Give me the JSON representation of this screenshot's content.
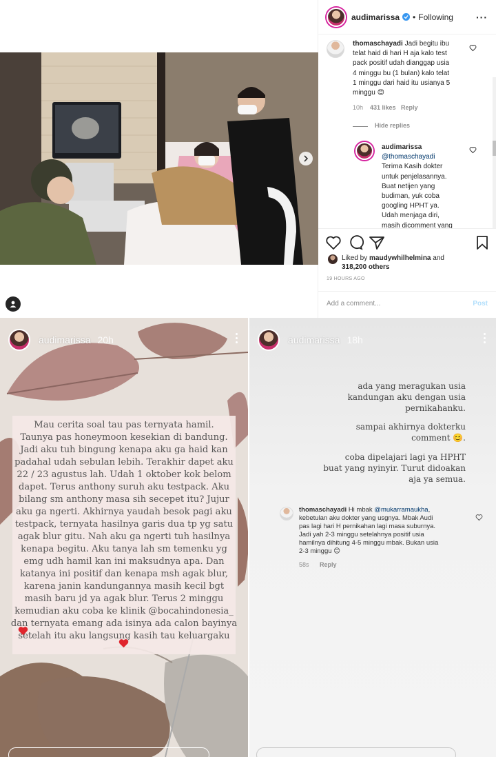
{
  "post": {
    "username": "audimarissa",
    "following_label": "Following",
    "dot": "•",
    "more": "···",
    "comment1": {
      "user": "thomaschayadi",
      "lines": [
        "Jadi begitu ibu",
        "telat haid di hari H aja kalo test",
        "pack positif udah dianggap usia",
        "4 minggu bu (1 bulan) kalo telat",
        "1 minggu dari haid itu usianya 5",
        "minggu 😊"
      ],
      "time": "10h",
      "likes": "431 likes",
      "reply": "Reply"
    },
    "hide_replies": "Hide replies",
    "reply1": {
      "user": "audimarissa",
      "mention": "@thomaschayadi",
      "lines": [
        "Terima Kasih dokter",
        "untuk penjelasannya.",
        "Buat netijen yang",
        "budiman, yuk coba",
        "googling HPHT ya.",
        "Udah menjaga diri,",
        "masih dicomment yang"
      ]
    },
    "liked_by_prefix": "Liked by",
    "liked_by_user": "maudywhilhelmina",
    "liked_by_and": "and",
    "liked_count": "318,200 others",
    "time_ago": "19 HOURS AGO",
    "add_comment_placeholder": "Add a comment...",
    "post_label": "Post"
  },
  "story1": {
    "username": "audimarissa",
    "time": "20h",
    "lines": [
      "Mau cerita soal tau pas ternyata hamil.",
      "Taunya pas honeymoon kesekian di bandung.",
      "Jadi aku tuh bingung kenapa aku ga haid kan",
      "padahal udah sebulan lebih. Terakhir dapet aku",
      "22 / 23 agustus lah. Udah 1 oktober kok belom",
      "dapet. Terus anthony suruh aku testpack. Aku",
      "bilang sm anthony masa sih secepet itu? Jujur",
      "aku ga ngerti. Akhirnya yaudah besok pagi aku",
      "testpack, ternyata hasilnya garis dua tp yg satu",
      "agak blur gitu. Nah aku ga ngerti tuh hasilnya",
      "kenapa begitu. Aku tanya lah sm temenku yg",
      "emg udh hamil kan ini maksudnya apa. Dan",
      "katanya ini positif dan kenapa msh agak blur,",
      "karena janin kandungannya masih kecil bgt",
      "masih baru jd ya agak blur. Terus 2 minggu",
      "kemudian aku coba ke klinik @bocahindonesia_",
      "dan ternyata emang ada isinya ada calon bayinya",
      "setelah itu aku langsung kasih tau keluargaku"
    ]
  },
  "story2": {
    "username": "audimarissa",
    "time": "18h",
    "lines": [
      "ada yang meragukan usia",
      "kandungan aku dengan usia",
      "pernikahanku.",
      "",
      "sampai akhirnya dokterku",
      "comment 😊.",
      "",
      "coba dipelajari lagi ya HPHT",
      "buat yang nyinyir. Turut didoakan",
      "aja ya semua."
    ],
    "comment": {
      "user": "thomaschayadi",
      "greeting": "Hi mbak",
      "mention": "@mukarramaukha",
      "first_tail": ",",
      "lines": [
        "kebetulan aku dokter yang usgnya. Mbak Audi",
        "pas lagi hari H pernikahan lagi masa suburnya.",
        "Jadi yah 2-3 minggu setelahnya positif usia",
        "hamilnya dihitung 4-5 minggu mbak. Bukan usia",
        "2-3 minggu 😊"
      ],
      "time": "58s",
      "reply": "Reply"
    }
  }
}
